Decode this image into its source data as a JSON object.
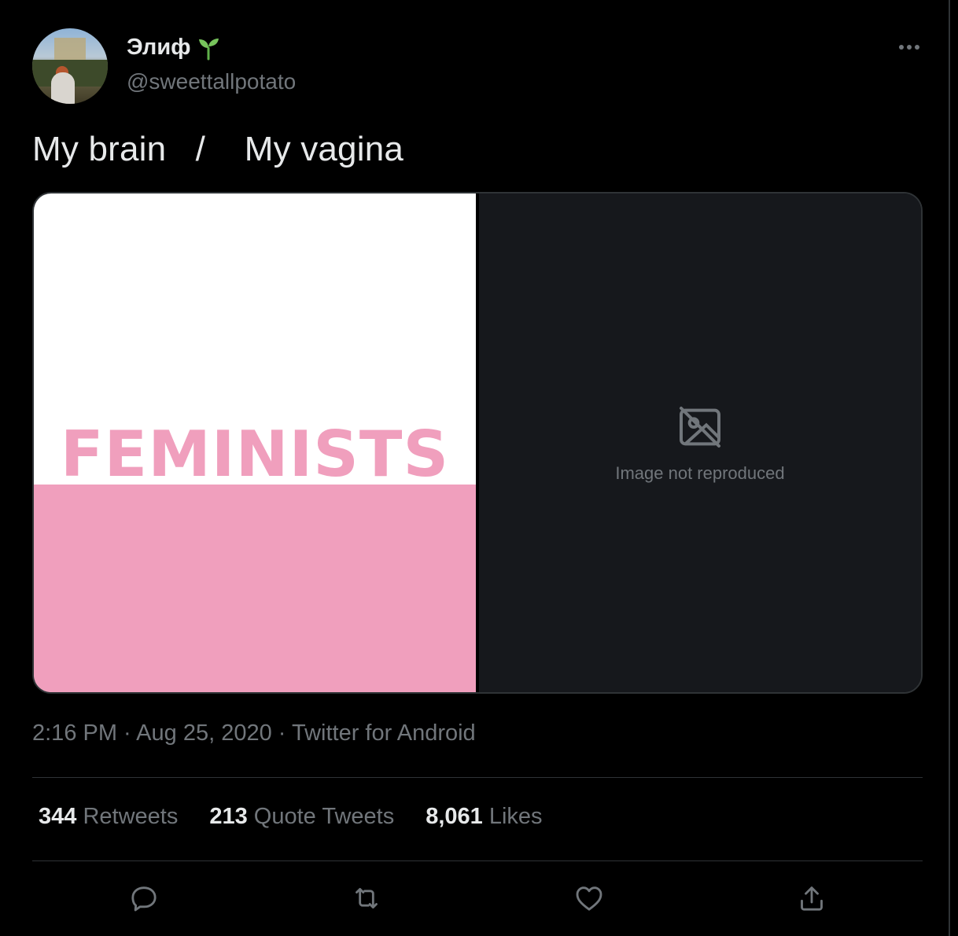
{
  "tweet": {
    "author": {
      "name": "Элиф",
      "handle": "@sweettallpotato"
    },
    "text": "My brain   /    My vagina",
    "media": {
      "left_word": "FEMINISTS",
      "placeholder_text": "Image not reproduced"
    },
    "meta": {
      "time": "2:16 PM",
      "sep1": " · ",
      "date": "Aug 25, 2020",
      "sep2": " · ",
      "source": "Twitter for Android"
    },
    "stats": [
      {
        "num": "344",
        "label": "Retweets"
      },
      {
        "num": "213",
        "label": "Quote Tweets"
      },
      {
        "num": "8,061",
        "label": "Likes"
      }
    ]
  },
  "colors": {
    "background": "#000000",
    "text": "#e7e9ea",
    "muted": "#71767b",
    "border": "#2f3336",
    "pink": "#f09fbd"
  },
  "icons": [
    "sprout-icon",
    "more-icon",
    "reply-icon",
    "retweet-icon",
    "like-icon",
    "share-icon",
    "image-hidden-icon"
  ]
}
